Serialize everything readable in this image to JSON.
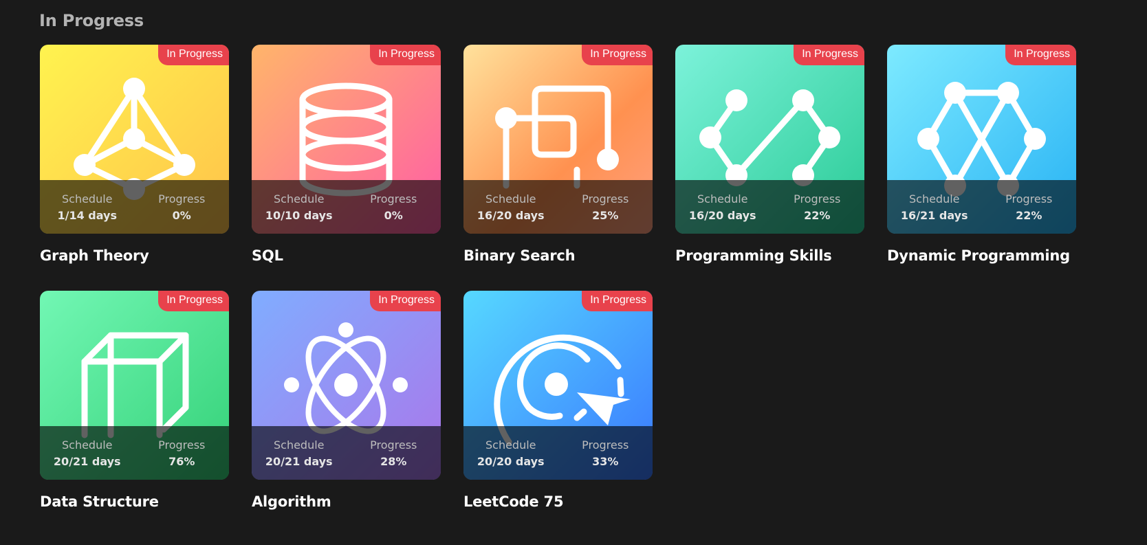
{
  "section": {
    "title": "In Progress"
  },
  "labels": {
    "schedule": "Schedule",
    "progress": "Progress"
  },
  "plans": [
    {
      "name": "Graph Theory",
      "badge": "In Progress",
      "schedule": "1/14 days",
      "progress": "0%",
      "icon": "graph-icon",
      "colors": [
        "#fff04f",
        "#ffc24a"
      ]
    },
    {
      "name": "SQL",
      "badge": "In Progress",
      "schedule": "10/10 days",
      "progress": "0%",
      "icon": "database-icon",
      "colors": [
        "#ffb36a",
        "#ff5fa3"
      ]
    },
    {
      "name": "Binary Search",
      "badge": "In Progress",
      "schedule": "16/20 days",
      "progress": "25%",
      "icon": "binary-search-icon",
      "colors": [
        "#ffe09a",
        "#ff8e52"
      ]
    },
    {
      "name": "Programming Skills",
      "badge": "In Progress",
      "schedule": "16/20 days",
      "progress": "22%",
      "icon": "code-icon",
      "colors": [
        "#7bf0d8",
        "#2bcf9b"
      ]
    },
    {
      "name": "Dynamic Programming",
      "badge": "In Progress",
      "schedule": "16/21 days",
      "progress": "22%",
      "icon": "dynamic-programming-icon",
      "colors": [
        "#7beaff",
        "#29b6f6"
      ]
    },
    {
      "name": "Data Structure",
      "badge": "In Progress",
      "schedule": "20/21 days",
      "progress": "76%",
      "icon": "cube-icon",
      "colors": [
        "#6ff7b0",
        "#35d27a"
      ]
    },
    {
      "name": "Algorithm",
      "badge": "In Progress",
      "schedule": "20/21 days",
      "progress": "28%",
      "icon": "atom-icon",
      "colors": [
        "#7eaaff",
        "#a779ec"
      ]
    },
    {
      "name": "LeetCode 75",
      "badge": "In Progress",
      "schedule": "20/20 days",
      "progress": "33%",
      "icon": "target-icon",
      "colors": [
        "#56d6ff",
        "#3a7bff"
      ]
    }
  ]
}
